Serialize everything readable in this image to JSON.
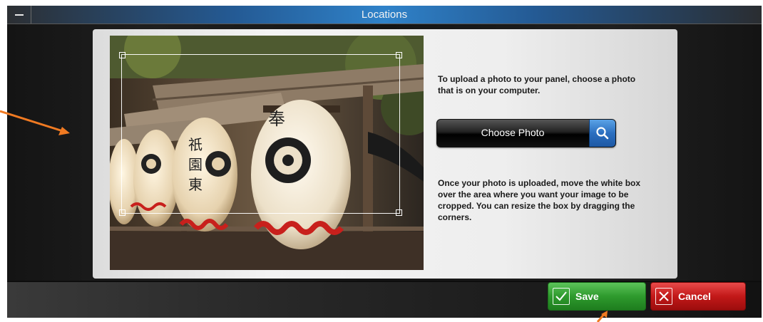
{
  "window": {
    "title": "Locations"
  },
  "upload": {
    "instruction_1": "To upload a photo to your panel, choose a photo that is on your computer.",
    "choose_label": "Choose Photo",
    "instruction_2": "Once your photo is uploaded, move the white box over the area where you want your image to be cropped. You can resize the box by dragging the corners."
  },
  "actions": {
    "save_label": "Save",
    "cancel_label": "Cancel"
  },
  "colors": {
    "accent_blue": "#2f82c9",
    "save_green": "#2e9a2d",
    "cancel_red": "#c21818",
    "annotation_orange": "#f07a22"
  },
  "icons": [
    "minimize-icon",
    "search-icon",
    "checkmark-icon",
    "x-icon",
    "annotation-arrow"
  ]
}
